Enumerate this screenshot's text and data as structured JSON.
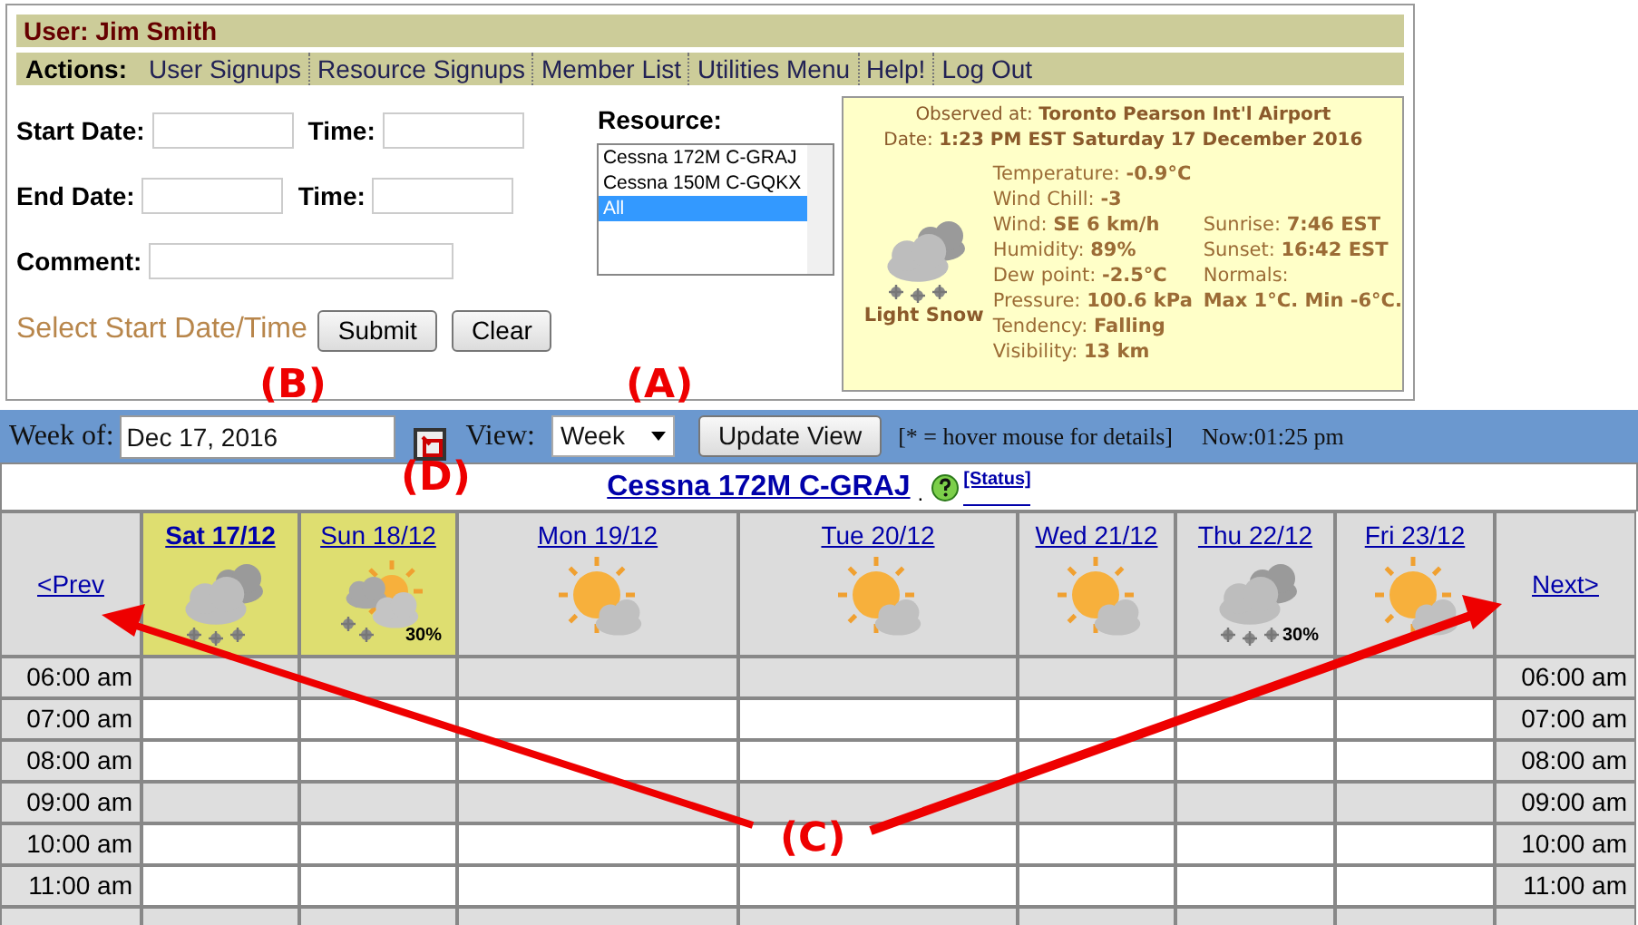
{
  "user_bar": {
    "text": "User: Jim Smith"
  },
  "actions": {
    "label": "Actions:",
    "links": [
      "User Signups",
      "Resource Signups",
      "Member List",
      "Utilities Menu",
      "Help!",
      "Log Out"
    ]
  },
  "form": {
    "rows": [
      {
        "label": "Start Date:",
        "time_label": "Time:"
      },
      {
        "label": "End Date:",
        "time_label": "Time:"
      },
      {
        "label": "Comment:"
      }
    ],
    "prompt": "Select Start Date/Time",
    "buttons": [
      "Submit",
      "Clear"
    ]
  },
  "resource": {
    "label": "Resource:",
    "options": [
      {
        "text": "Cessna 172M C-GRAJ",
        "selected": false
      },
      {
        "text": "Cessna 150M C-GQKX",
        "selected": false
      },
      {
        "text": "All",
        "selected": true
      }
    ]
  },
  "weather": {
    "observed": "Observed at: **Toronto Pearson Int'l Airport**",
    "date": "Date: **1:23 PM EST Saturday 17 December 2016**",
    "kind": "snow",
    "condition": "Light Snow",
    "details": [
      "Temperature: **-0.9°C**",
      "Wind Chill: **-3**",
      "Wind: **SE 6 km/h**",
      "Humidity: **89%**",
      "Dew point: **-2.5°C**",
      "Pressure: **100.6 kPa**",
      "Tendency: **Falling**",
      "Visibility: **13 km**"
    ],
    "almanac": [
      "Sunrise: **7:46 EST**",
      "Sunset: **16:42 EST**",
      "Normals:",
      "**Max 1°C. Min -6°C.**"
    ]
  },
  "toolbar": {
    "week_label": "Week of:",
    "week_value": "Dec 17, 2016",
    "view_label": "View:",
    "view_value": "Week",
    "update_button": "Update View",
    "hint": "[* = hover mouse for details]",
    "now": "Now:01:25 pm"
  },
  "calendar": {
    "title": "Cessna 172M C-GRAJ",
    "dot": ".",
    "status_link": "[Status]",
    "prev": "<Prev",
    "next": "Next>",
    "days": [
      {
        "label": "Sat 17/12",
        "today": true,
        "highlighted": true,
        "kind": "snow"
      },
      {
        "label": "Sun 18/12",
        "today": false,
        "highlighted": true,
        "kind": "sun-snow",
        "pop": "30%"
      },
      {
        "label": "Mon 19/12",
        "today": false,
        "highlighted": false,
        "kind": "sun-cloud"
      },
      {
        "label": "Tue 20/12",
        "today": false,
        "highlighted": false,
        "kind": "sun-cloud"
      },
      {
        "label": "Wed 21/12",
        "today": false,
        "highlighted": false,
        "kind": "sun-cloud"
      },
      {
        "label": "Thu 22/12",
        "today": false,
        "highlighted": false,
        "kind": "snow",
        "pop": "30%"
      },
      {
        "label": "Fri 23/12",
        "today": false,
        "highlighted": false,
        "kind": "sun-cloud"
      }
    ],
    "times": [
      {
        "left": "06:00 am",
        "right": "06:00 am",
        "shaded": true
      },
      {
        "left": "07:00 am",
        "right": "07:00 am",
        "shaded": false
      },
      {
        "left": "08:00 am",
        "right": "08:00 am",
        "shaded": false
      },
      {
        "left": "09:00 am",
        "right": "09:00 am",
        "shaded": true
      },
      {
        "left": "10:00 am",
        "right": "10:00 am",
        "shaded": false
      },
      {
        "left": "11:00 am",
        "right": "11:00 am",
        "shaded": false
      }
    ]
  },
  "annotations": [
    "(A)",
    "(B)",
    "(C)",
    "(D)"
  ]
}
